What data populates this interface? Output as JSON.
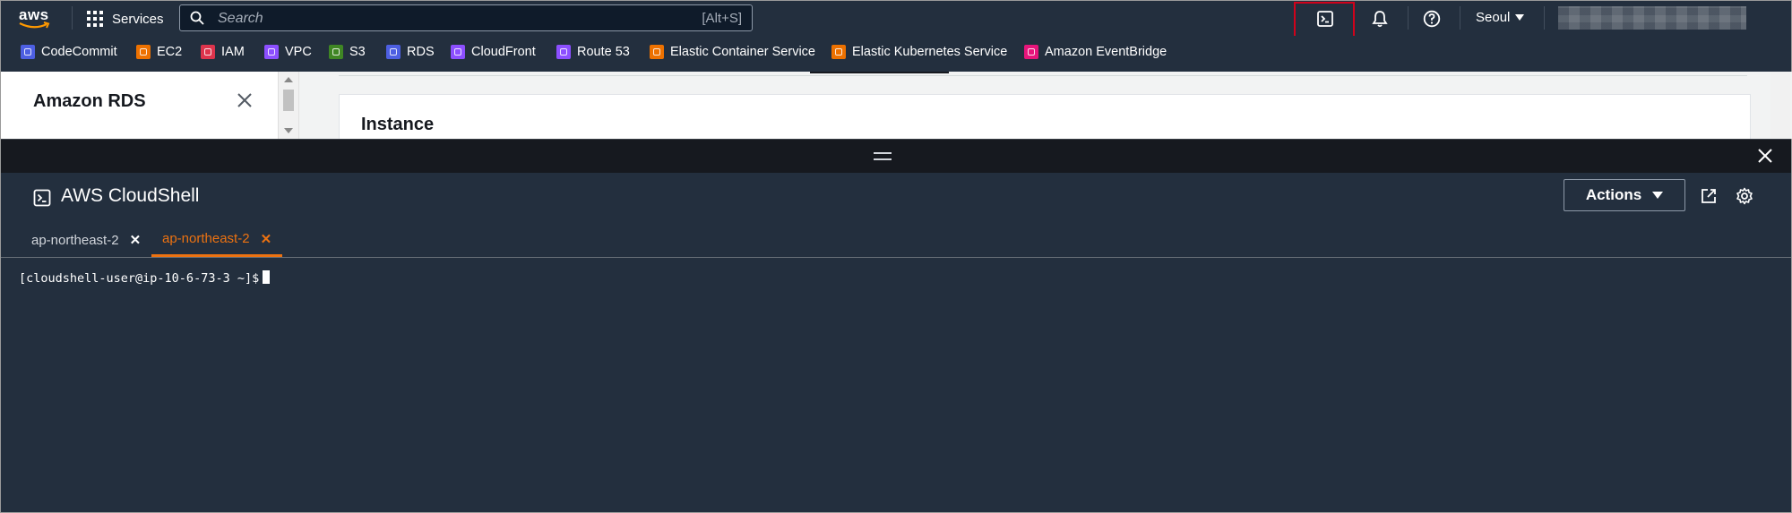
{
  "topnav": {
    "logo_text": "aws",
    "services_label": "Services",
    "search_placeholder": "Search",
    "search_shortcut": "[Alt+S]",
    "region": "Seoul",
    "icons": [
      "cloudshell-icon",
      "bell-icon",
      "help-icon"
    ]
  },
  "favorites": [
    {
      "label": "CodeCommit",
      "color": "#4d5fe2"
    },
    {
      "label": "EC2",
      "color": "#ed7100"
    },
    {
      "label": "IAM",
      "color": "#dd344c"
    },
    {
      "label": "VPC",
      "color": "#8c4fff"
    },
    {
      "label": "S3",
      "color": "#3f8624"
    },
    {
      "label": "RDS",
      "color": "#4d5fe2"
    },
    {
      "label": "CloudFront",
      "color": "#8c4fff"
    },
    {
      "label": "Route 53",
      "color": "#8c4fff"
    },
    {
      "label": "Elastic Container Service",
      "color": "#ed7100"
    },
    {
      "label": "Elastic Kubernetes Service",
      "color": "#ed7100"
    },
    {
      "label": "Amazon EventBridge",
      "color": "#e7157b"
    }
  ],
  "background_page": {
    "side_title": "Amazon RDS",
    "card_title": "Instance"
  },
  "cloudshell": {
    "title": "AWS CloudShell",
    "actions_label": "Actions",
    "tabs": [
      {
        "label": "ap-northeast-2",
        "active": false
      },
      {
        "label": "ap-northeast-2",
        "active": true
      }
    ],
    "prompt": "[cloudshell-user@ip-10-6-73-3 ~]$"
  },
  "colors": {
    "nav_bg": "#232f3e",
    "accent": "#ec7211",
    "highlight": "#d0021b"
  }
}
